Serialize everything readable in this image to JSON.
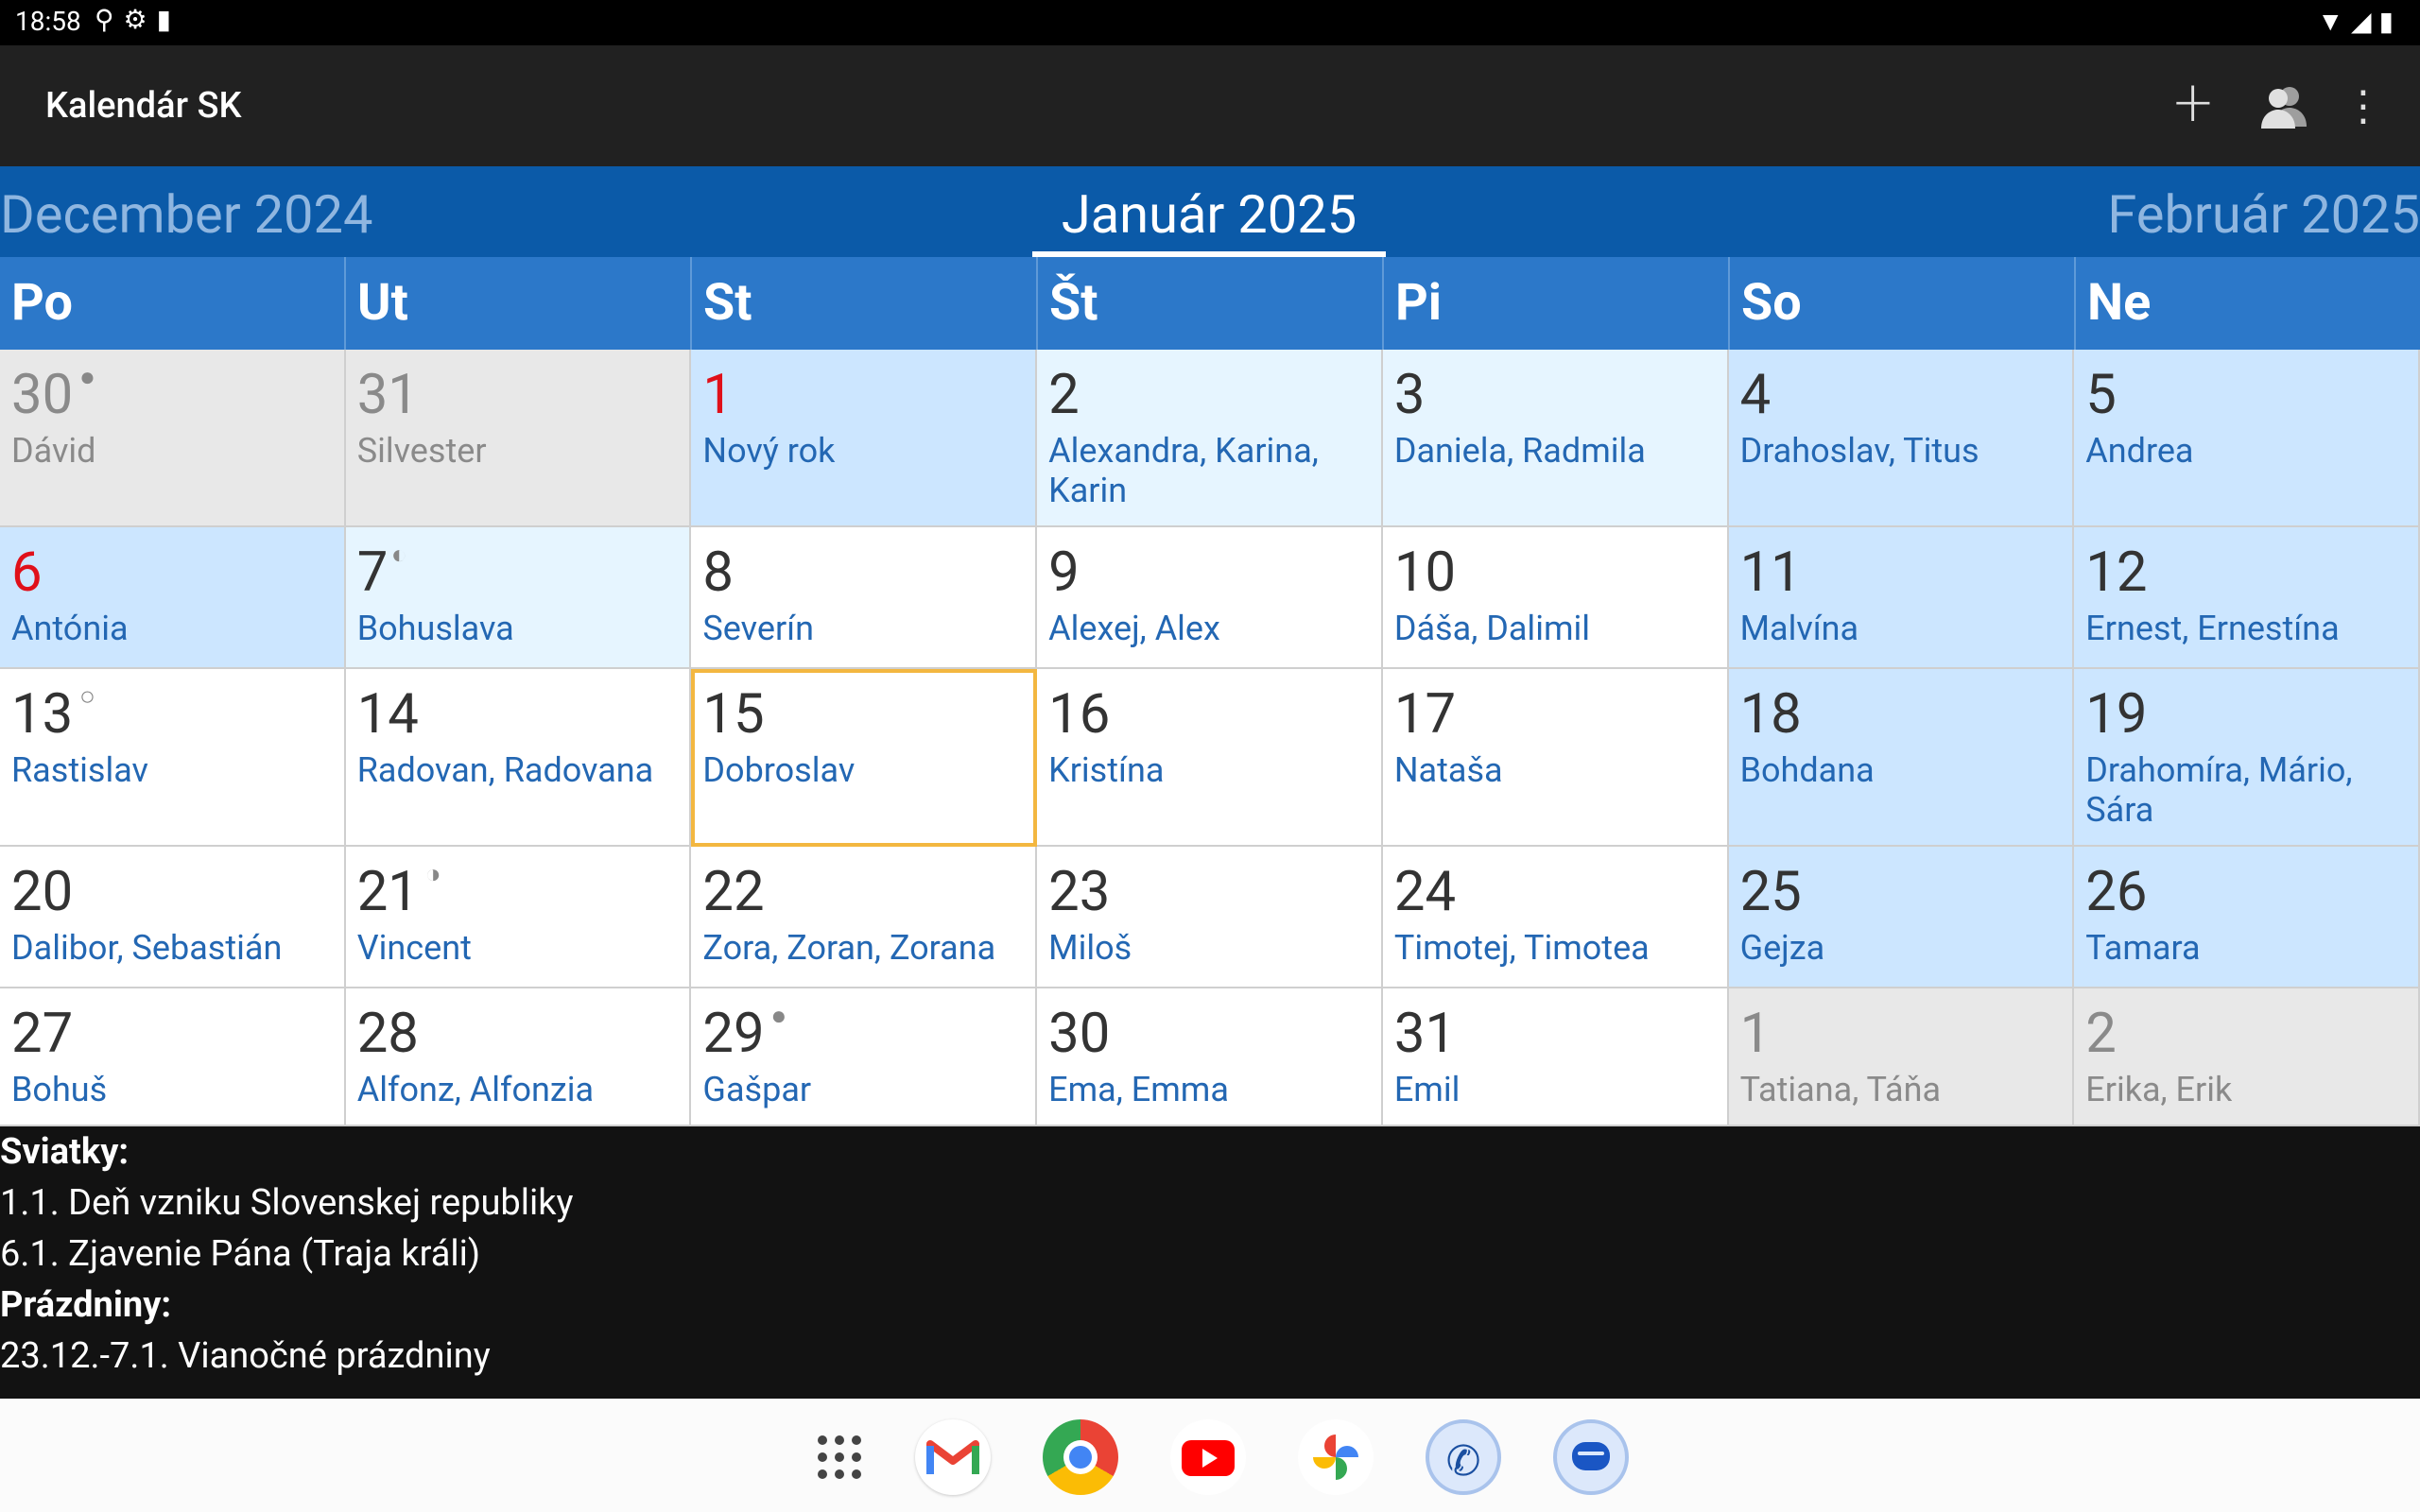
{
  "status_bar": {
    "time": "18:58"
  },
  "app_bar": {
    "title": "Kalendár SK"
  },
  "month_header": {
    "prev": "December 2024",
    "current": "Január 2025",
    "next": "Február 2025"
  },
  "weekdays": [
    "Po",
    "Ut",
    "St",
    "Št",
    "Pi",
    "So",
    "Ne"
  ],
  "weeks": [
    [
      {
        "day": "30",
        "names": "Dávid"
      },
      {
        "day": "31",
        "names": "Silvester"
      },
      {
        "day": "1",
        "names": "Nový rok"
      },
      {
        "day": "2",
        "names": "Alexandra, Karina, Karin"
      },
      {
        "day": "3",
        "names": "Daniela, Radmila"
      },
      {
        "day": "4",
        "names": "Drahoslav, Titus"
      },
      {
        "day": "5",
        "names": "Andrea"
      }
    ],
    [
      {
        "day": "6",
        "names": "Antónia"
      },
      {
        "day": "7",
        "names": "Bohuslava"
      },
      {
        "day": "8",
        "names": "Severín"
      },
      {
        "day": "9",
        "names": "Alexej, Alex"
      },
      {
        "day": "10",
        "names": "Dáša, Dalimil"
      },
      {
        "day": "11",
        "names": "Malvína"
      },
      {
        "day": "12",
        "names": "Ernest, Ernestína"
      }
    ],
    [
      {
        "day": "13",
        "names": "Rastislav"
      },
      {
        "day": "14",
        "names": "Radovan, Radovana"
      },
      {
        "day": "15",
        "names": "Dobroslav"
      },
      {
        "day": "16",
        "names": "Kristína"
      },
      {
        "day": "17",
        "names": "Nataša"
      },
      {
        "day": "18",
        "names": "Bohdana"
      },
      {
        "day": "19",
        "names": "Drahomíra, Mário, Sára"
      }
    ],
    [
      {
        "day": "20",
        "names": "Dalibor, Sebastián"
      },
      {
        "day": "21",
        "names": "Vincent"
      },
      {
        "day": "22",
        "names": "Zora, Zoran, Zorana"
      },
      {
        "day": "23",
        "names": "Miloš"
      },
      {
        "day": "24",
        "names": "Timotej, Timotea"
      },
      {
        "day": "25",
        "names": "Gejza"
      },
      {
        "day": "26",
        "names": "Tamara"
      }
    ],
    [
      {
        "day": "27",
        "names": "Bohuš"
      },
      {
        "day": "28",
        "names": "Alfonz, Alfonzia"
      },
      {
        "day": "29",
        "names": "Gašpar"
      },
      {
        "day": "30",
        "names": "Ema, Emma"
      },
      {
        "day": "31",
        "names": "Emil"
      },
      {
        "day": "1",
        "names": "Tatiana, Táňa"
      },
      {
        "day": "2",
        "names": "Erika, Erik"
      }
    ]
  ],
  "notes": {
    "holidays_title": "Sviatky:",
    "holiday_1": "1.1. Deň vzniku Slovenskej republiky",
    "holiday_2": "6.1. Zjavenie Pána (Traja králi)",
    "vacation_title": "Prázdniny:",
    "vacation_1": "23.12.-7.1. Vianočné prázdniny"
  },
  "colors": {
    "month_bar": "#0b5aa8",
    "weekday_bar": "#2c78c9",
    "cell_weekend": "#cce6ff",
    "cell_light": "#e6f5ff",
    "cell_other_month": "#e8e8e8",
    "holiday_red": "#e0101a",
    "names_blue": "#2367b3",
    "today_outline": "#f3b740"
  },
  "dock_icons": [
    "app-drawer-icon",
    "gmail-icon",
    "chrome-icon",
    "youtube-icon",
    "photos-icon",
    "phone-icon",
    "messages-icon"
  ]
}
